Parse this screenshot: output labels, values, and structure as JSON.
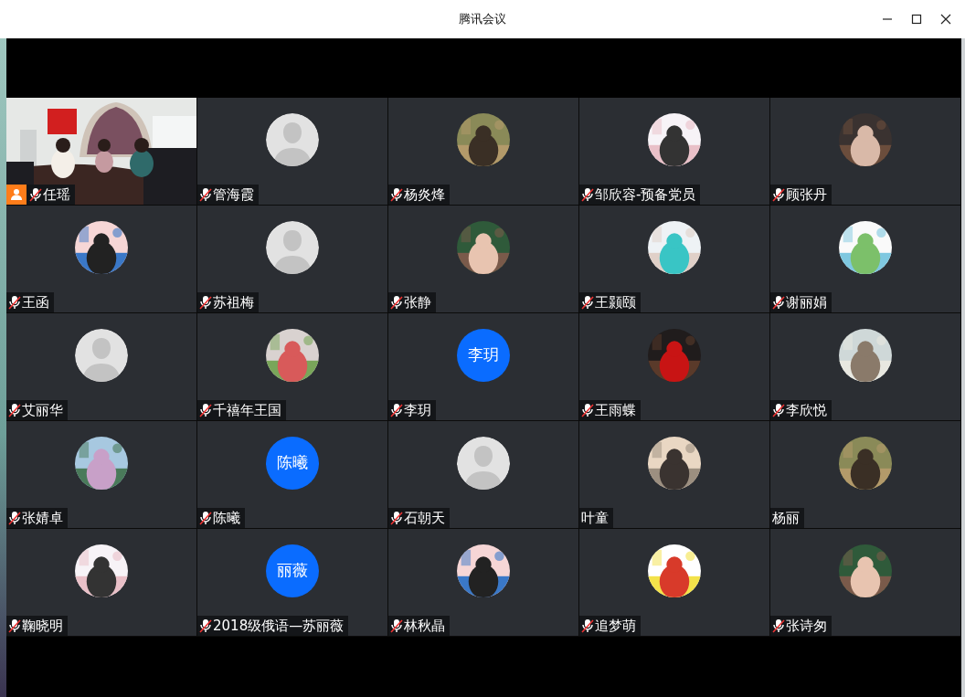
{
  "window": {
    "title": "腾讯会议"
  },
  "participants": [
    {
      "name": "任瑶",
      "muted": true,
      "kind": "video",
      "host": true
    },
    {
      "name": "管海霞",
      "muted": true,
      "kind": "default",
      "host": false
    },
    {
      "name": "杨炎烽",
      "muted": true,
      "host": false
    },
    {
      "name": "邹欣容-预备党员",
      "muted": true,
      "host": false
    },
    {
      "name": "顾张丹",
      "muted": true,
      "host": false
    },
    {
      "name": "王函",
      "muted": true,
      "host": false
    },
    {
      "name": "苏祖梅",
      "muted": true,
      "kind": "default",
      "host": false
    },
    {
      "name": "张静",
      "muted": true,
      "host": false
    },
    {
      "name": "王颢颐",
      "muted": true,
      "host": false
    },
    {
      "name": "谢丽娟",
      "muted": true,
      "host": false
    },
    {
      "name": "艾丽华",
      "muted": true,
      "kind": "default",
      "host": false
    },
    {
      "name": "千禧年王国",
      "muted": true,
      "host": false
    },
    {
      "name": "李玥",
      "muted": true,
      "kind": "initials",
      "initials": "李玥",
      "host": false
    },
    {
      "name": "王雨蝶",
      "muted": true,
      "host": false
    },
    {
      "name": "李欣悦",
      "muted": true,
      "host": false
    },
    {
      "name": "张婧卓",
      "muted": true,
      "host": false
    },
    {
      "name": "陈曦",
      "muted": true,
      "kind": "initials",
      "initials": "陈曦",
      "host": false
    },
    {
      "name": "石朝天",
      "muted": true,
      "kind": "default",
      "host": false
    },
    {
      "name": "叶童",
      "muted": false,
      "host": false
    },
    {
      "name": "杨丽",
      "muted": false,
      "host": false
    },
    {
      "name": "鞠晓明",
      "muted": true,
      "host": false
    },
    {
      "name": "2018级俄语—苏丽薇",
      "muted": true,
      "kind": "initials",
      "initials": "丽薇",
      "host": false
    },
    {
      "name": "林秋晶",
      "muted": true,
      "host": false
    },
    {
      "name": "追梦萌",
      "muted": true,
      "host": false
    },
    {
      "name": "张诗匆",
      "muted": true,
      "host": false
    }
  ]
}
